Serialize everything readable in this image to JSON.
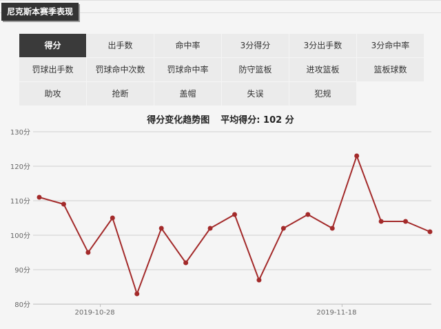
{
  "section_label": "尼克斯本赛季表现",
  "tabs": [
    {
      "label": "得分",
      "active": true
    },
    {
      "label": "出手数",
      "active": false
    },
    {
      "label": "命中率",
      "active": false
    },
    {
      "label": "3分得分",
      "active": false
    },
    {
      "label": "3分出手数",
      "active": false
    },
    {
      "label": "3分命中率",
      "active": false
    },
    {
      "label": "罚球出手数",
      "active": false
    },
    {
      "label": "罚球命中次数",
      "active": false
    },
    {
      "label": "罚球命中率",
      "active": false
    },
    {
      "label": "防守篮板",
      "active": false
    },
    {
      "label": "进攻篮板",
      "active": false
    },
    {
      "label": "篮板球数",
      "active": false
    },
    {
      "label": "助攻",
      "active": false
    },
    {
      "label": "抢断",
      "active": false
    },
    {
      "label": "盖帽",
      "active": false
    },
    {
      "label": "失误",
      "active": false
    },
    {
      "label": "犯规",
      "active": false
    }
  ],
  "chart_title": {
    "main": "得分变化趋势图",
    "avg_label": "平均得分:",
    "avg_value": "102",
    "avg_unit": "分"
  },
  "colors": {
    "line": "#a32a2a",
    "active_tab": "#3a3a3a",
    "tab": "#ebebeb"
  },
  "chart_data": {
    "type": "line",
    "y_unit": "分",
    "ylim": [
      80,
      130
    ],
    "yticks": [
      80,
      90,
      100,
      110,
      120,
      130
    ],
    "grid": true,
    "series": [
      {
        "values": [
          111,
          109,
          95,
          105,
          83,
          102,
          92,
          102,
          106,
          87,
          102,
          106,
          102,
          123,
          104,
          104,
          101
        ]
      }
    ],
    "x_labels": [
      {
        "index": 2.5,
        "label": "2019-10-28"
      },
      {
        "index": 12.4,
        "label": "2019-11-18"
      }
    ]
  }
}
